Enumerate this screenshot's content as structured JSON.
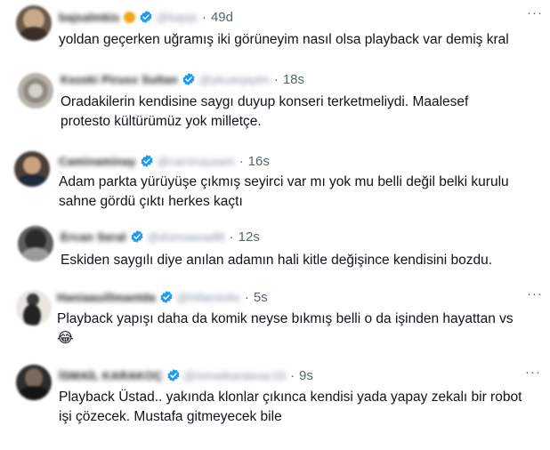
{
  "colors": {
    "text": "#0f1419",
    "muted": "#536471",
    "verified_blue": "#1d9bf0",
    "background": "#ffffff"
  },
  "icons": {
    "verified": "verified-badge-icon",
    "more": "more-options-icon",
    "avatar": "avatar-image"
  },
  "more_glyph": "···",
  "separator": "·",
  "tweets": [
    {
      "display_name": "bajsalmkis",
      "handle": "@bajsjs",
      "time": "49d",
      "text_lines": [
        "yoldan geçerken uğramış iki görüneyim nasıl olsa playback var demiş kral"
      ],
      "emoji": ""
    },
    {
      "display_name": "Kezeki Pirusx Sultan",
      "handle": "@pkuanjaylm",
      "time": "18s",
      "text_lines": [
        "Oradakilerin kendisine saygı duyup konseri terketmeliydi. Maalesef",
        "protesto kültürümüz yok milletçe."
      ],
      "emoji": ""
    },
    {
      "display_name": "Caminaminay",
      "handle": "@caminayaam",
      "time": "16s",
      "text_lines": [
        "Adam parkta yürüyüşe çıkmış seyirci var mı yok mu belli değil belki kurulu",
        "sahne gördü çıktı herkes kaçtı"
      ],
      "emoji": ""
    },
    {
      "display_name": "Ercan Seral",
      "handle": "@domowoadl8",
      "time": "12s",
      "text_lines": [
        "Eskiden saygılı diye anılan adamın hali kitle değişince kendisini bozdu."
      ],
      "emoji": ""
    },
    {
      "display_name": "Haniaauillmantda",
      "handle": "@hillaroinlio",
      "time": "5s",
      "text_lines": [
        "Playback yapışı daha da komik neyse bıkmış belli o da işinden hayattan vs"
      ],
      "emoji": "😂"
    },
    {
      "display_name": "İSMAİL KARAKOÇ",
      "handle": "@ismailkaraboac33",
      "time": "9s",
      "text_lines": [
        "Playback Üstad.. yakında klonlar çıkınca kendisi yada yapay zekalı bir robot",
        "işi çözecek. Mustafa gitmeyecek bile"
      ],
      "emoji": ""
    }
  ]
}
